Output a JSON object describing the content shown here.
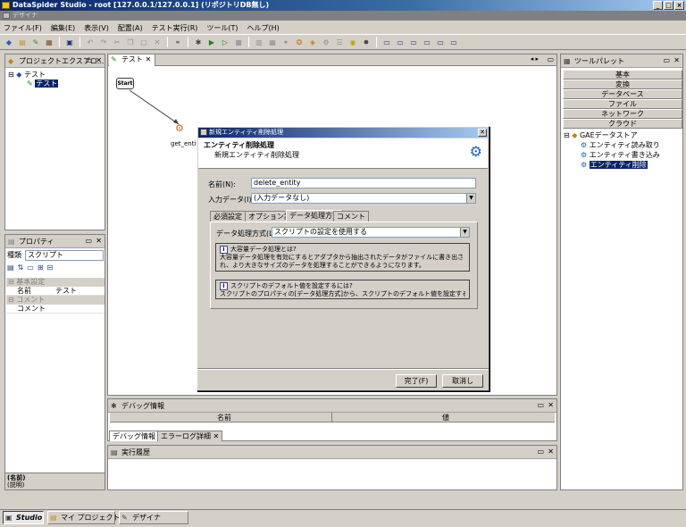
{
  "window": {
    "title": "DataSpider Studio - root [127.0.0.1/127.0.0.1] (リポジトリDB無し)",
    "subtitle": "デザイナ"
  },
  "menu": [
    "ファイル(F)",
    "編集(E)",
    "表示(V)",
    "配置(A)",
    "テスト実行(R)",
    "ツール(T)",
    "ヘルプ(H)"
  ],
  "project_explorer": {
    "title": "プロジェクトエクスプロ...",
    "root": "テスト",
    "child": "テスト"
  },
  "properties": {
    "title": "プロパティ",
    "type_label": "種類",
    "type_value": "スクリプト",
    "sections": [
      {
        "name": "基本設定",
        "rows": [
          {
            "key": "名前",
            "value": "テスト"
          }
        ]
      },
      {
        "name": "コメント",
        "rows": [
          {
            "key": "コメント",
            "value": ""
          }
        ]
      }
    ],
    "footer_name": "(名前)",
    "footer_desc": "(説明)"
  },
  "editor": {
    "tab": "テスト",
    "start_node": "Start",
    "entity_node": "get_entity"
  },
  "dialog": {
    "title": "新規エンティティ削除処理",
    "header_title": "エンティティ削除処理",
    "header_desc": "新規エンティティ削除処理",
    "name_label": "名前(N):",
    "name_value": "delete_entity",
    "input_label": "入力データ(I):",
    "input_value": "(入力データなし)",
    "tabs": [
      "必須設定",
      "オプション設定",
      "データ処理方式",
      "コメント"
    ],
    "method_label": "データ処理方式(L):",
    "method_value": "スクリプトの設定を使用する",
    "info1_title": "大容量データ処理とは?",
    "info1_body": "大容量データ処理を有効にするとアダプタから抽出されたデータがファイルに書き出され、より大きなサイズのデータを処理することができるようになります。",
    "info2_title": "スクリプトのデフォルト値を設定するには?",
    "info2_body": "スクリプトのプロパティの[データ処理方式]から、スクリプトのデフォルト値を設定することができます。",
    "finish_button": "完了(F)",
    "cancel_button": "取消し"
  },
  "debug": {
    "title": "デバッグ情報",
    "col_name": "名前",
    "col_value": "値",
    "tabs": [
      "デバッグ情報",
      "エラーログ詳細"
    ]
  },
  "history": {
    "title": "実行履歴"
  },
  "palette": {
    "title": "ツールパレット",
    "categories": [
      "基本",
      "変換",
      "データベース",
      "ファイル",
      "ネットワーク",
      "クラウド"
    ],
    "group": "GAEデータストア",
    "items": [
      "エンティティ読み取り",
      "エンティティ書き込み",
      "エンティティ削除"
    ]
  },
  "taskbar": [
    "Studio",
    "マイ プロジェクト",
    "デザイナ"
  ],
  "colors": {
    "selection": "#0a246a",
    "titlebar": "#0a246a",
    "chrome": "#d4d0c8"
  }
}
